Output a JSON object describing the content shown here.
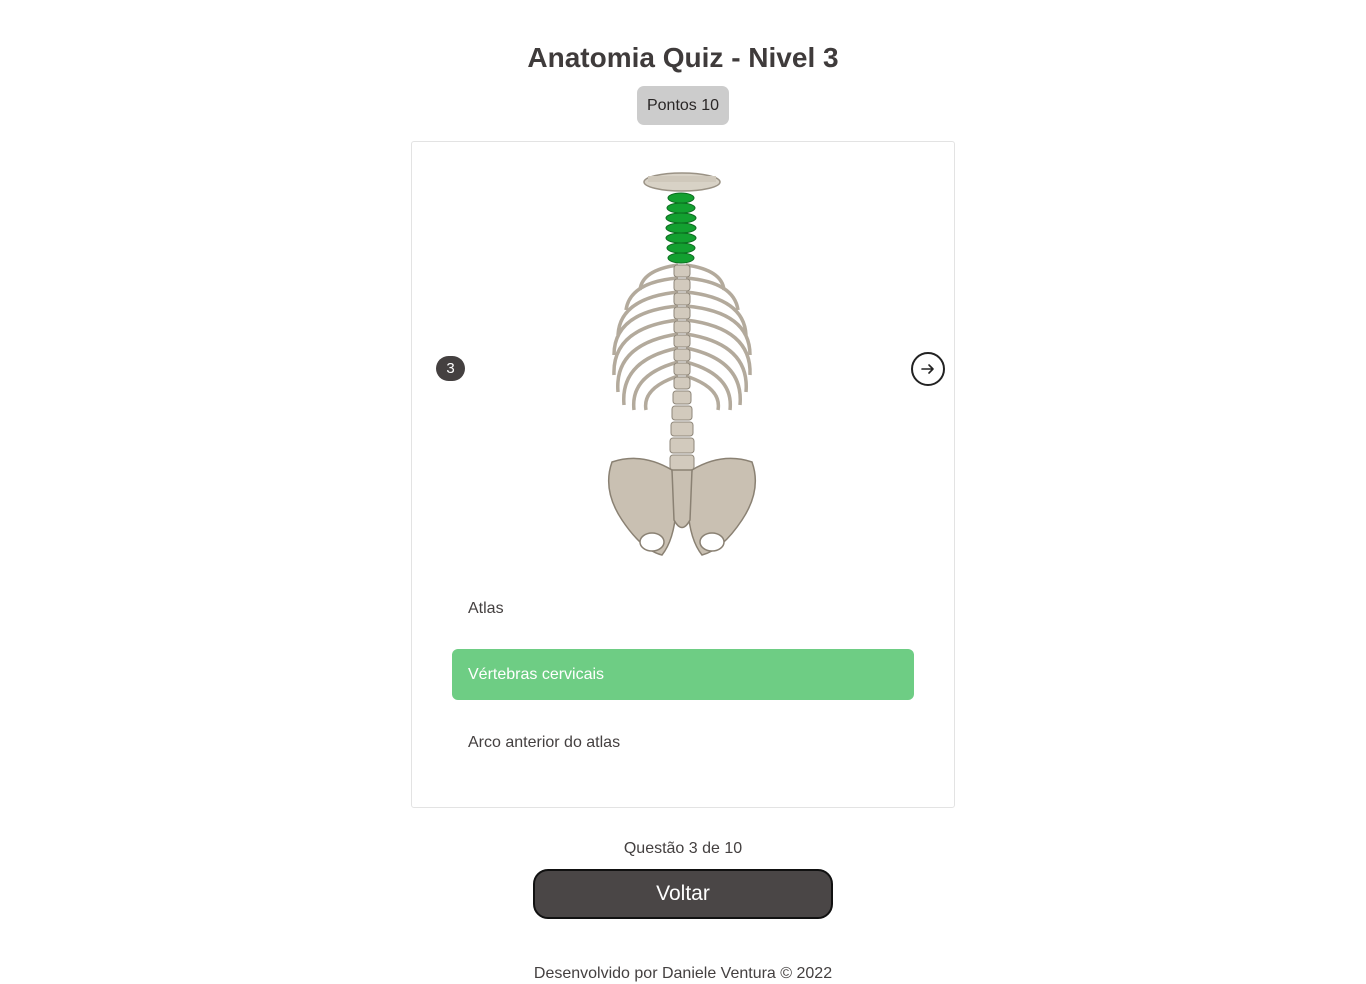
{
  "header": {
    "title": "Anatomia Quiz - Nivel 3",
    "score_label": "Pontos 10"
  },
  "quiz": {
    "question_number": "3",
    "image_icon": "skeleton-spine-illustration",
    "next_icon": "arrow-right-circle-icon",
    "highlight_color": "#13a030",
    "options": [
      {
        "label": "Atlas",
        "state": "default"
      },
      {
        "label": "Vértebras cervicais",
        "state": "correct"
      },
      {
        "label": "Arco anterior do atlas",
        "state": "default"
      }
    ]
  },
  "progress": {
    "text": "Questão 3 de 10"
  },
  "actions": {
    "back_label": "Voltar"
  },
  "footer": {
    "text": "Desenvolvido por Daniele Ventura © 2022"
  },
  "colors": {
    "correct": "#6ecd84",
    "primary_dark": "#4a4646",
    "score_bg": "#cccccc"
  }
}
